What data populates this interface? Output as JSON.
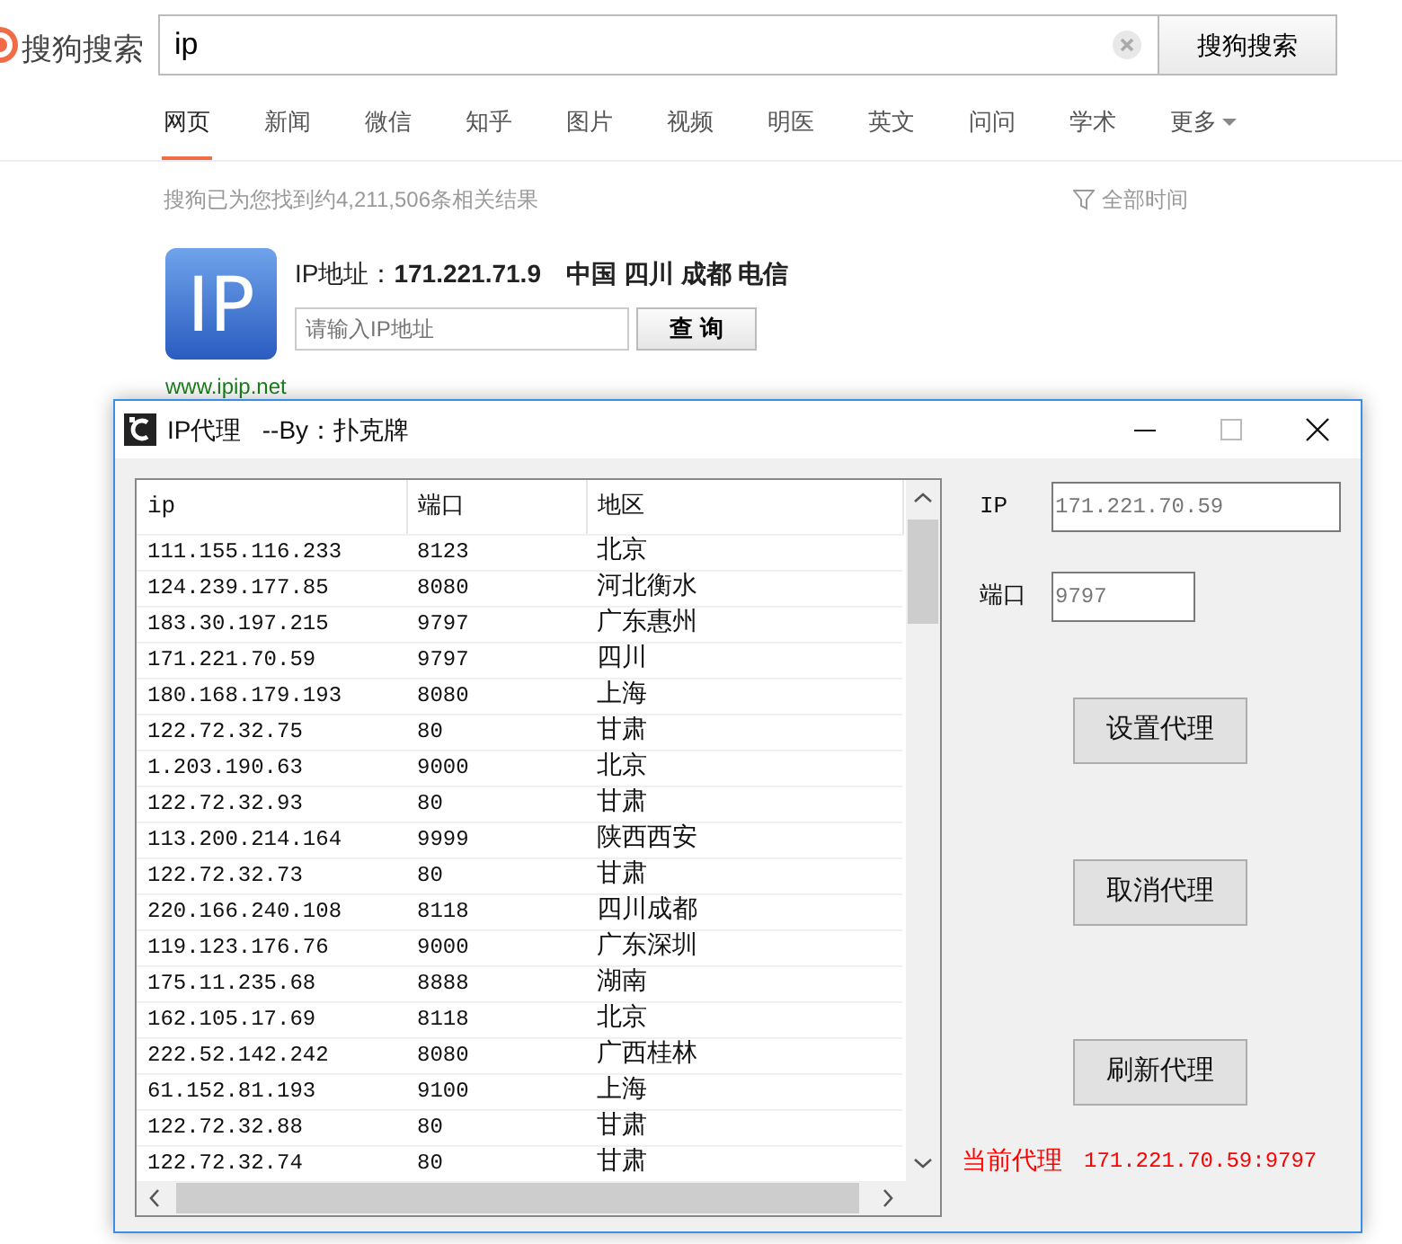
{
  "browser": {
    "logo": "搜狗搜索",
    "search": {
      "value": "ip"
    },
    "search_button": "搜狗搜索",
    "tabs": [
      {
        "label": "网页",
        "selected": true
      },
      {
        "label": "新闻",
        "selected": false
      },
      {
        "label": "微信",
        "selected": false
      },
      {
        "label": "知乎",
        "selected": false
      },
      {
        "label": "图片",
        "selected": false
      },
      {
        "label": "视频",
        "selected": false
      },
      {
        "label": "明医",
        "selected": false
      },
      {
        "label": "英文",
        "selected": false
      },
      {
        "label": "问问",
        "selected": false
      },
      {
        "label": "学术",
        "selected": false
      },
      {
        "label": "更多",
        "selected": false
      }
    ],
    "result_count": "搜狗已为您找到约4,211,506条相关结果",
    "time_filter": "全部时间",
    "ip_card": {
      "icon_text": "IP",
      "title": "IP地址：**171.221.71.9**　**中国 四川 成都 电信**",
      "input_placeholder": "请输入IP地址",
      "query_button": "查 询",
      "url": "www.ipip.net"
    }
  },
  "window": {
    "title": "IP代理   --By：扑克牌",
    "table": {
      "columns": [
        "ip",
        "端口",
        "地区"
      ],
      "rows": [
        [
          "111.155.116.233",
          "8123",
          "北京"
        ],
        [
          "124.239.177.85",
          "8080",
          "河北衡水"
        ],
        [
          "183.30.197.215",
          "9797",
          "广东惠州"
        ],
        [
          "171.221.70.59",
          "9797",
          "四川"
        ],
        [
          "180.168.179.193",
          "8080",
          "上海"
        ],
        [
          "122.72.32.75",
          "80",
          "甘肃"
        ],
        [
          "1.203.190.63",
          "9000",
          "北京"
        ],
        [
          "122.72.32.93",
          "80",
          "甘肃"
        ],
        [
          "113.200.214.164",
          "9999",
          "陕西西安"
        ],
        [
          "122.72.32.73",
          "80",
          "甘肃"
        ],
        [
          "220.166.240.108",
          "8118",
          "四川成都"
        ],
        [
          "119.123.176.76",
          "9000",
          "广东深圳"
        ],
        [
          "175.11.235.68",
          "8888",
          "湖南"
        ],
        [
          "162.105.17.69",
          "8118",
          "北京"
        ],
        [
          "222.52.142.242",
          "8080",
          "广西桂林"
        ],
        [
          "61.152.81.193",
          "9100",
          "上海"
        ],
        [
          "122.72.32.88",
          "80",
          "甘肃"
        ],
        [
          "122.72.32.74",
          "80",
          "甘肃"
        ]
      ]
    },
    "ip_label": "IP",
    "ip_value": "171.221.70.59",
    "port_label": "端口",
    "port_value": "9797",
    "buttons": [
      "设置代理",
      "取消代理",
      "刷新代理"
    ],
    "current_label": "当前代理",
    "current_value": "171.221.70.59:9797"
  }
}
